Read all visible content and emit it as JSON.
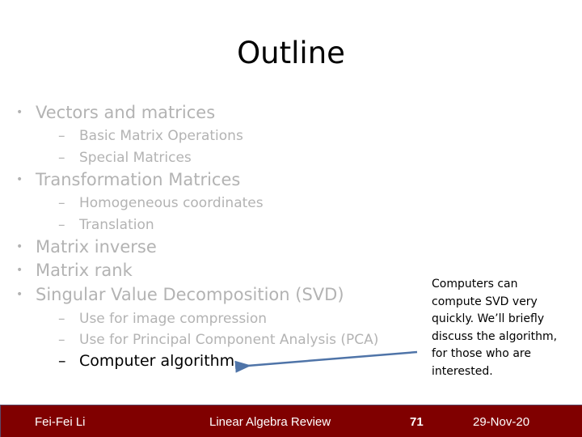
{
  "slide": {
    "title": "Outline",
    "outline": [
      {
        "label": "Vectors and matrices",
        "level": 1,
        "active": false
      },
      {
        "label": "Basic Matrix Operations",
        "level": 2,
        "active": false
      },
      {
        "label": "Special Matrices",
        "level": 2,
        "active": false
      },
      {
        "label": "Transformation Matrices",
        "level": 1,
        "active": false
      },
      {
        "label": "Homogeneous coordinates",
        "level": 2,
        "active": false
      },
      {
        "label": "Translation",
        "level": 2,
        "active": false
      },
      {
        "label": "Matrix inverse",
        "level": 1,
        "active": false
      },
      {
        "label": "Matrix rank",
        "level": 1,
        "active": false
      },
      {
        "label": "Singular Value Decomposition (SVD)",
        "level": 1,
        "active": false
      },
      {
        "label": "Use for image compression",
        "level": 2,
        "active": false
      },
      {
        "label": "Use for Principal Component Analysis (PCA)",
        "level": 2,
        "active": false
      },
      {
        "label": "Computer algorithm",
        "level": 2,
        "active": true
      }
    ],
    "bullet_glyph": "•",
    "dash_glyph": "–",
    "note": "Computers can compute SVD very quickly. We’ll briefly discuss the algorithm, for those who are interested.",
    "colors": {
      "inactive_text": "#b3b3b3",
      "active_text": "#000000",
      "arrow": "#4f74a8",
      "footer_bg": "#800000"
    }
  },
  "footer": {
    "author": "Fei-Fei Li",
    "course": "Linear Algebra Review",
    "page": "71",
    "date": "29-Nov-20"
  }
}
